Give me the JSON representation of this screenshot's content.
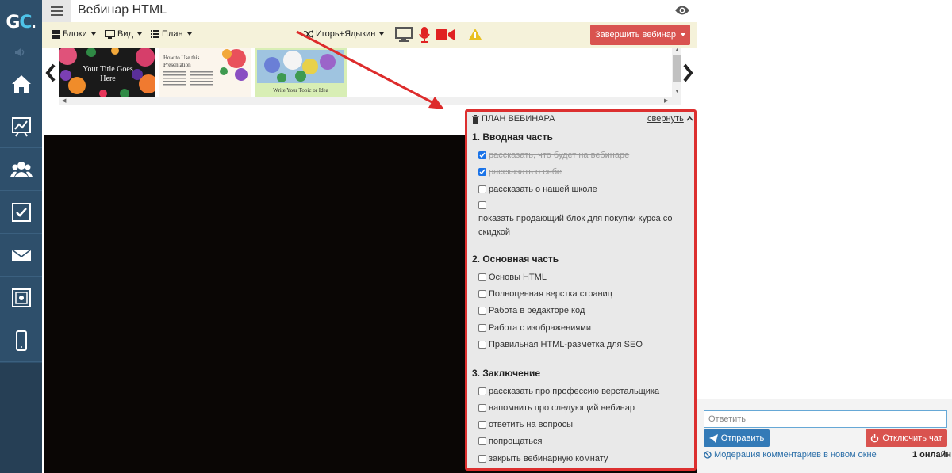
{
  "app": {
    "logo_text": "GC",
    "logo_dot": ".",
    "title": "Вебинар HTML"
  },
  "toolbar": {
    "blocks_label": "Блоки",
    "view_label": "Вид",
    "plan_label": "План",
    "user_label": "Игорь+Ядыкин",
    "end_webinar_label": "Завершить вебинар"
  },
  "slides": [
    {
      "text": "Your Title Goes Here"
    },
    {
      "text": "How to Use this Presentation"
    },
    {
      "text": "Write Your Topic or Idea"
    }
  ],
  "plan": {
    "header": "ПЛАН ВЕБИНАРА",
    "collapse_label": "свернуть",
    "sections": [
      {
        "title": "1. Вводная часть",
        "items": [
          {
            "label": "рассказать, что будет на вебинаре",
            "checked": true
          },
          {
            "label": "рассказать о себе",
            "checked": true
          },
          {
            "label": "рассказать о нашей школе",
            "checked": false
          },
          {
            "label": "показать продающий блок для покупки курса со скидкой",
            "checked": false
          }
        ]
      },
      {
        "title": "2. Основная часть",
        "items": [
          {
            "label": "Основы HTML",
            "checked": false
          },
          {
            "label": "Полноценная верстка страниц",
            "checked": false
          },
          {
            "label": "Работа в редакторе код",
            "checked": false
          },
          {
            "label": "Работа с изображениями",
            "checked": false
          },
          {
            "label": "Правильная HTML-разметка для SEO",
            "checked": false
          }
        ]
      },
      {
        "title": "3. Заключение",
        "items": [
          {
            "label": "рассказать про профессию верстальщика",
            "checked": false
          },
          {
            "label": "напомнить про следующий вебинар",
            "checked": false
          },
          {
            "label": "ответить на вопросы",
            "checked": false
          },
          {
            "label": "попрощаться",
            "checked": false
          },
          {
            "label": "закрыть вебинарную комнату",
            "checked": false
          }
        ]
      }
    ]
  },
  "chat": {
    "reply_placeholder": "Ответить",
    "send_label": "Отправить",
    "disable_chat_label": "Отключить чат",
    "moderation_label": "Модерация комментариев в новом окне",
    "online_count": "1 онлайн"
  },
  "colors": {
    "sidebar": "#2e4f6b",
    "toolbar_bg": "#f5f2da",
    "end_button": "#d9534f",
    "send_button": "#337ab7",
    "plan_border": "#dc2f2f",
    "checkbox_checked": "#1a73e8"
  },
  "icons": [
    "menu-icon",
    "eye-icon",
    "grid-icon",
    "monitor-icon",
    "list-icon",
    "shuffle-icon",
    "screen-share-icon",
    "microphone-icon",
    "camera-icon",
    "warning-icon",
    "home-icon",
    "chart-icon",
    "users-icon",
    "checkbox-icon",
    "mail-icon",
    "safe-icon",
    "mobile-icon",
    "trash-icon",
    "chevron-up-icon",
    "paper-plane-icon",
    "power-icon",
    "ban-icon"
  ]
}
